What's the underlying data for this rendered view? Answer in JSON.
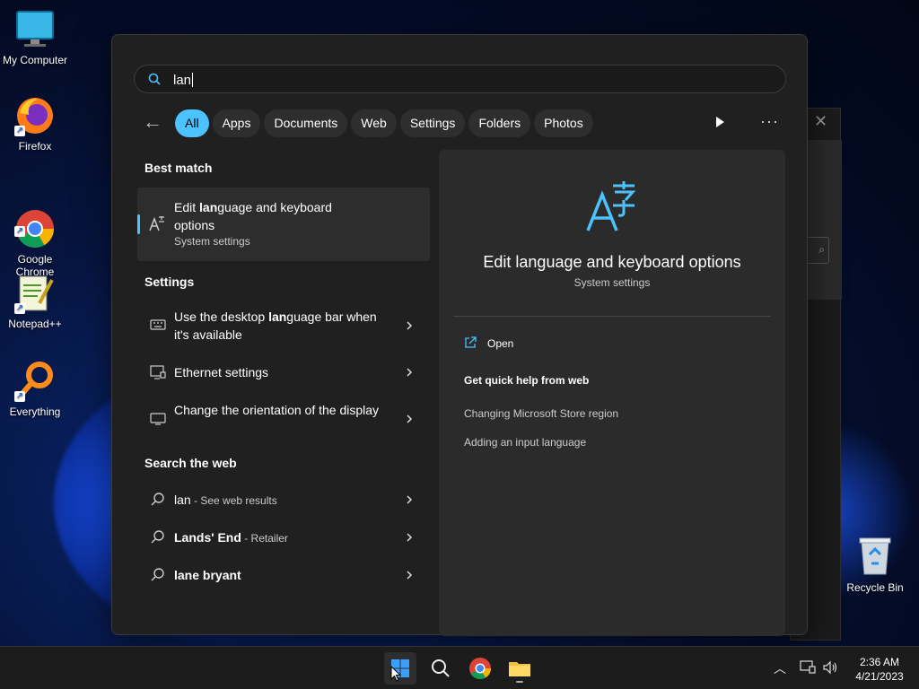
{
  "desktop": {
    "icons": [
      {
        "label": "My Computer",
        "icon": "monitor-icon"
      },
      {
        "label": "Firefox",
        "icon": "firefox-icon"
      },
      {
        "label": "Google\nChrome",
        "icon": "chrome-icon"
      },
      {
        "label": "Notepad++",
        "icon": "notepadpp-icon"
      },
      {
        "label": "Everything",
        "icon": "everything-icon"
      }
    ],
    "recycle_bin": "Recycle Bin"
  },
  "search": {
    "query": "lan",
    "filters": [
      "All",
      "Apps",
      "Documents",
      "Web",
      "Settings",
      "Folders",
      "Photos"
    ],
    "active_filter": "All"
  },
  "results": {
    "best_match_heading": "Best match",
    "best_match": {
      "title_pre": "Edit ",
      "title_bold": "lan",
      "title_post": "guage and keyboard options",
      "subtitle": "System settings"
    },
    "settings_heading": "Settings",
    "settings": [
      {
        "pre": "Use the desktop ",
        "bold": "lan",
        "post": "guage bar when it's available",
        "icon": "keyboard-icon"
      },
      {
        "pre": "Ethernet settings",
        "bold": "",
        "post": "",
        "icon": "ethernet-icon"
      },
      {
        "pre": "Change the orientation of the display",
        "bold": "",
        "post": "",
        "icon": "display-icon"
      }
    ],
    "web_heading": "Search the web",
    "web": [
      {
        "bold": "",
        "plain": "lan",
        "sub": " - See web results"
      },
      {
        "bold": "Lands' End",
        "plain": "",
        "sub": " - Retailer"
      },
      {
        "bold": "lane bryant",
        "plain": "",
        "sub": ""
      }
    ]
  },
  "detail": {
    "title": "Edit language and keyboard options",
    "subtitle": "System settings",
    "open_label": "Open",
    "help_heading": "Get quick help from web",
    "links": [
      "Changing Microsoft Store region",
      "Adding an input language"
    ]
  },
  "taskbar": {
    "time": "2:36 AM",
    "date": "4/21/2023"
  },
  "colors": {
    "accent": "#4cc2ff",
    "panel": "#202020",
    "detail": "#2b2b2b"
  }
}
